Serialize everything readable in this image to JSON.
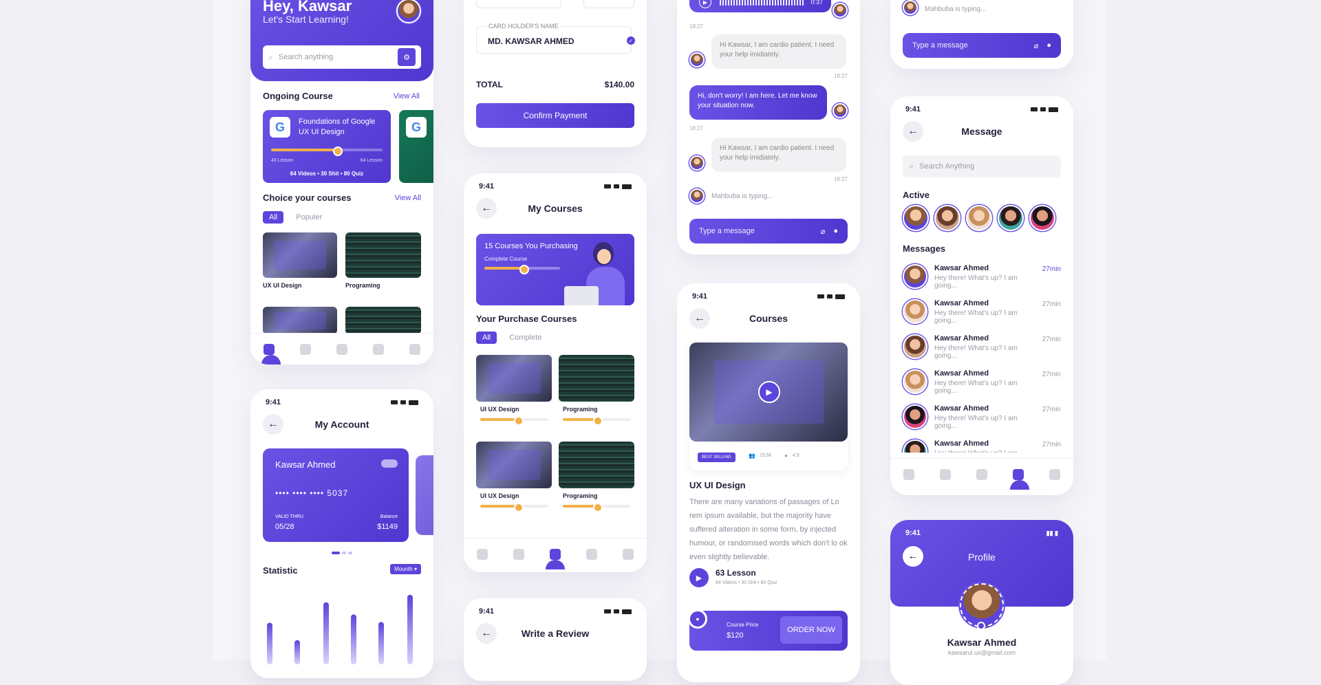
{
  "status_time": "9:41",
  "home": {
    "greeting": "Hey, Kawsar",
    "subtitle": "Let's Start Learning!",
    "search_placeholder": "Search anything",
    "ongoing_title": "Ongoing Course",
    "view_all": "View All",
    "course": {
      "title": "Foundations of Google UX UI Design",
      "lessons_done": "43 Lesson",
      "lessons_total": "64 Lesson",
      "meta": "64 Videos • 30 Shit • 80 Quiz",
      "progress": 0.62
    },
    "choice_title": "Choice your courses",
    "tabs": [
      "All",
      "Populer"
    ],
    "cards": [
      {
        "title": "UX UI Design"
      },
      {
        "title": "Programing"
      }
    ]
  },
  "payment": {
    "holder_label": "CARD HOLDER'S NAME",
    "holder_name": "MD. KAWSAR AHMED",
    "total_label": "TOTAL",
    "total_value": "$140.00",
    "confirm": "Confirm Payment"
  },
  "my_courses": {
    "title": "My Courses",
    "banner_title": "15 Courses You Purchasing",
    "banner_sub": "Complete Course",
    "purchase_title": "Your Purchase Courses",
    "tabs": [
      "All",
      "Complete"
    ],
    "items": [
      {
        "title": "UI UX Design"
      },
      {
        "title": "Programing"
      },
      {
        "title": "UI UX Design"
      },
      {
        "title": "Programing"
      }
    ]
  },
  "review": {
    "title": "Write a Review"
  },
  "account": {
    "title": "My Account",
    "card_name": "Kawsar Ahmed",
    "card_number": "•••• •••• •••• 5037",
    "valid_label": "VALID THRU",
    "valid_value": "05/28",
    "balance_label": "Balance",
    "balance_value": "$1149",
    "statistic": "Statistic",
    "period": "Mounth",
    "chart_data": {
      "type": "bar",
      "values": [
        55,
        32,
        82,
        66,
        56,
        92
      ]
    }
  },
  "chat": {
    "audio_time": "0:37",
    "messages": [
      {
        "dir": "in",
        "text": "Hi Kawsar, I am cardio patient. I need your help imidiately.",
        "time": "18:27"
      },
      {
        "dir": "out",
        "text": "Hi, don't worry! I am here. Let me know your situation now.",
        "time": "18:27"
      },
      {
        "dir": "in",
        "text": "Hi Kawsar, I am cardio patient. I need your help imidiately.",
        "time": "18:27"
      }
    ],
    "first_time": "18:27",
    "typing": "Mahbuba is typing...",
    "placeholder": "Type a message"
  },
  "course_detail": {
    "title": "Courses",
    "badge": "BEST SELLING",
    "students": "23.5k",
    "rating": "4.9",
    "name": "UX UI Design",
    "desc": "There are many variations of passages of Lo rem ipsum available, but the majority have suffered alteration in some form, by injected humour, or randomised words which don't lo ok even slightly believable.",
    "lessons": "63 Lesson",
    "lessons_meta": "64 Videos • 30 Shit • 80 Quiz",
    "price_label": "Course Price",
    "price": "$120",
    "order": "ORDER NOW"
  },
  "chat_top": {
    "typing": "Mahbuba is typing...",
    "placeholder": "Type a message"
  },
  "messages": {
    "title": "Message",
    "search": "Search Anything",
    "active": "Active",
    "messages_label": "Messages",
    "list": [
      {
        "name": "Kawsar Ahmed",
        "text": "Hey there! What's up? I am going...",
        "time": "27min"
      },
      {
        "name": "Kawsar Ahmed",
        "text": "Hey there! What's up? I am going...",
        "time": "27min"
      },
      {
        "name": "Kawsar Ahmed",
        "text": "Hey there! What's up? I am going...",
        "time": "27min"
      },
      {
        "name": "Kawsar Ahmed",
        "text": "Hey there! What's up? I am going...",
        "time": "27min"
      },
      {
        "name": "Kawsar Ahmed",
        "text": "Hey there! What's up? I am going...",
        "time": "27min"
      },
      {
        "name": "Kawsar Ahmed",
        "text": "Hey there! What's up? I am going...",
        "time": "27min"
      }
    ]
  },
  "profile": {
    "title": "Profile",
    "name": "Kawsar Ahmed",
    "email": "kawsarul.ux@gmail.com"
  }
}
